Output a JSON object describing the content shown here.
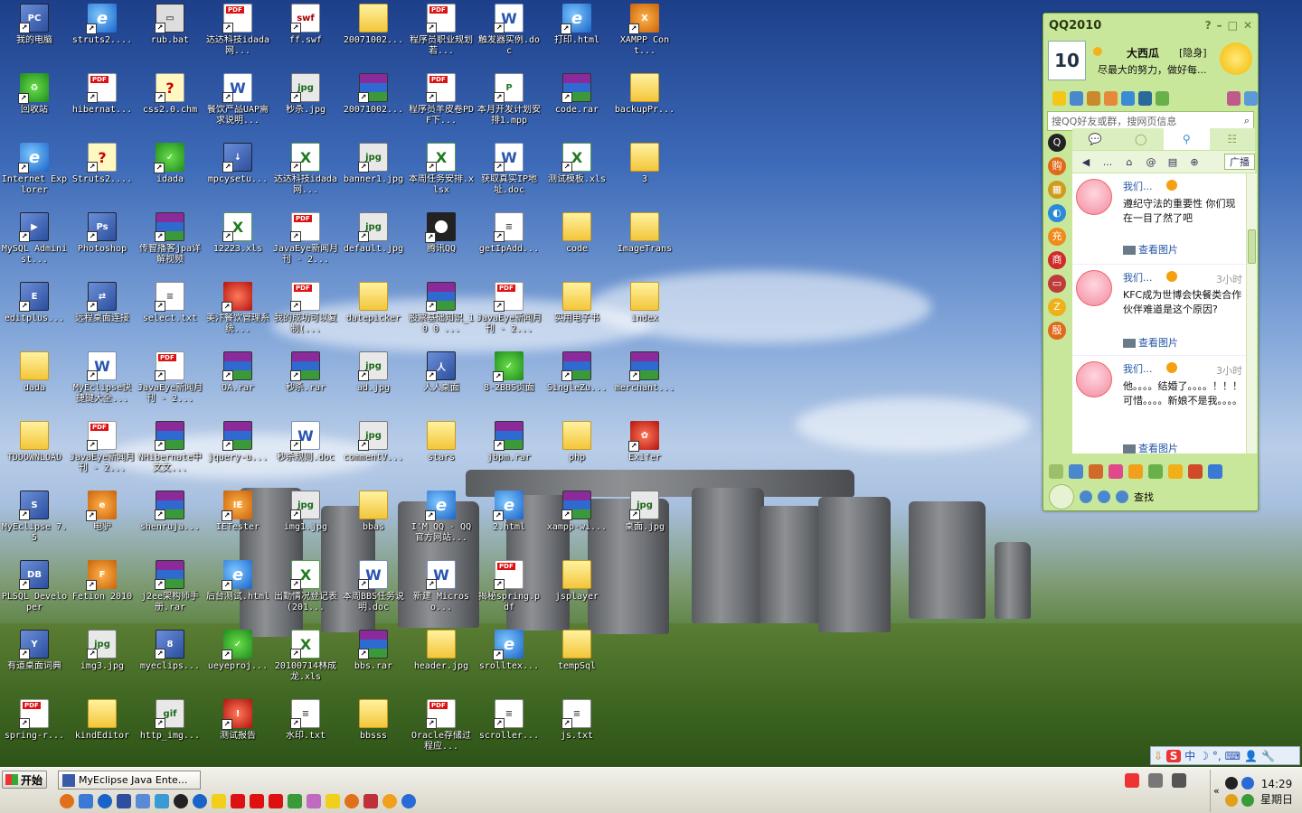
{
  "desktop": {
    "icons": [
      {
        "label": "我的电脑",
        "type": "app",
        "glyph": "PC"
      },
      {
        "label": "回收站",
        "type": "green",
        "glyph": "♻"
      },
      {
        "label": "Internet Explorer",
        "type": "ie",
        "glyph": "e"
      },
      {
        "label": "MySQL Administ...",
        "type": "app",
        "glyph": "▶"
      },
      {
        "label": "editplus...",
        "type": "app",
        "glyph": "E"
      },
      {
        "label": "dada",
        "type": "folder",
        "glyph": ""
      },
      {
        "label": "TDDOWNLOAD",
        "type": "folder",
        "glyph": ""
      },
      {
        "label": "MyEclipse 7.5",
        "type": "app",
        "glyph": "S"
      },
      {
        "label": "PLSQL Developer",
        "type": "app",
        "glyph": "DB"
      },
      {
        "label": "有道桌面词典",
        "type": "app",
        "glyph": "Y"
      },
      {
        "label": "spring-r...",
        "type": "pdf",
        "glyph": ""
      },
      {
        "label": "struts2....",
        "type": "ie",
        "glyph": "e"
      },
      {
        "label": "hibernat...",
        "type": "pdf",
        "glyph": ""
      },
      {
        "label": "Struts2....",
        "type": "chm",
        "glyph": "?"
      },
      {
        "label": "Photoshop",
        "type": "app",
        "glyph": "Ps"
      },
      {
        "label": "远程桌面连接",
        "type": "app",
        "glyph": "⇄"
      },
      {
        "label": "MyEclipse快捷键大全...",
        "type": "doc",
        "glyph": "W"
      },
      {
        "label": "JavaEye新闻月刊 - 2...",
        "type": "pdf",
        "glyph": ""
      },
      {
        "label": "电驴",
        "type": "orange",
        "glyph": "e"
      },
      {
        "label": "Fetion 2010",
        "type": "orange",
        "glyph": "F"
      },
      {
        "label": "img3.jpg",
        "type": "jpg",
        "glyph": "jpg"
      },
      {
        "label": "kindEditor",
        "type": "folder",
        "glyph": ""
      },
      {
        "label": "rub.bat",
        "type": "bat",
        "glyph": "▭"
      },
      {
        "label": "css2.0.chm",
        "type": "chm",
        "glyph": "?"
      },
      {
        "label": "idada",
        "type": "green",
        "glyph": "✓"
      },
      {
        "label": "传智播客jpa详解视频",
        "type": "rar",
        "glyph": ""
      },
      {
        "label": "select.txt",
        "type": "txt",
        "glyph": "≡"
      },
      {
        "label": "JavaEye新闻月刊 - 2...",
        "type": "pdf",
        "glyph": ""
      },
      {
        "label": "NHibernate中文文...",
        "type": "rar",
        "glyph": ""
      },
      {
        "label": "shenruja...",
        "type": "rar",
        "glyph": ""
      },
      {
        "label": "j2ee架构师手册.rar",
        "type": "rar",
        "glyph": ""
      },
      {
        "label": "myeclips...",
        "type": "app",
        "glyph": "8"
      },
      {
        "label": "http_img...",
        "type": "jpg",
        "glyph": "gif"
      },
      {
        "label": "达达科技idada网...",
        "type": "pdf",
        "glyph": ""
      },
      {
        "label": "餐饮产品UAP需求说明...",
        "type": "doc",
        "glyph": "W"
      },
      {
        "label": "mpcysetu...",
        "type": "app",
        "glyph": "↓"
      },
      {
        "label": "12223.xls",
        "type": "xls",
        "glyph": "X"
      },
      {
        "label": "美汴餐饮管理系统...",
        "type": "red",
        "glyph": ""
      },
      {
        "label": "OA.rar",
        "type": "rar",
        "glyph": ""
      },
      {
        "label": "jquery-u...",
        "type": "rar",
        "glyph": ""
      },
      {
        "label": "IETester",
        "type": "orange",
        "glyph": "IE"
      },
      {
        "label": "后台测试.html",
        "type": "ie",
        "glyph": "e"
      },
      {
        "label": "ueyeproj...",
        "type": "green",
        "glyph": "✓"
      },
      {
        "label": "测试报告",
        "type": "red",
        "glyph": "!"
      },
      {
        "label": "ff.swf",
        "type": "swf",
        "glyph": "swf"
      },
      {
        "label": "秒杀.jpg",
        "type": "jpg",
        "glyph": "jpg"
      },
      {
        "label": "达达科技idada网...",
        "type": "xls",
        "glyph": "X"
      },
      {
        "label": "JavaEye新闻月刊 - 2...",
        "type": "pdf",
        "glyph": ""
      },
      {
        "label": "我的成功可以复制(...",
        "type": "pdf",
        "glyph": ""
      },
      {
        "label": "秒杀.rar",
        "type": "rar",
        "glyph": ""
      },
      {
        "label": "秒杀规则.doc",
        "type": "doc",
        "glyph": "W"
      },
      {
        "label": "img1.jpg",
        "type": "jpg",
        "glyph": "jpg"
      },
      {
        "label": "出勤情况登记表(201...",
        "type": "xls",
        "glyph": "X"
      },
      {
        "label": "20100714林成龙.xls",
        "type": "xls",
        "glyph": "X"
      },
      {
        "label": "水印.txt",
        "type": "txt",
        "glyph": "≡"
      },
      {
        "label": "20071002...",
        "type": "folder",
        "glyph": ""
      },
      {
        "label": "20071002...",
        "type": "rar",
        "glyph": ""
      },
      {
        "label": "banner1.jpg",
        "type": "jpg",
        "glyph": "jpg"
      },
      {
        "label": "default.jpg",
        "type": "jpg",
        "glyph": "jpg"
      },
      {
        "label": "datepicker",
        "type": "folder",
        "glyph": ""
      },
      {
        "label": "ad.jpg",
        "type": "jpg",
        "glyph": "jpg"
      },
      {
        "label": "commentV...",
        "type": "jpg",
        "glyph": "jpg"
      },
      {
        "label": "bbas",
        "type": "folder",
        "glyph": ""
      },
      {
        "label": "本周BBS任务说明.doc",
        "type": "doc",
        "glyph": "W"
      },
      {
        "label": "bbs.rar",
        "type": "rar",
        "glyph": ""
      },
      {
        "label": "bbsss",
        "type": "folder",
        "glyph": ""
      },
      {
        "label": "程序员职业规划若...",
        "type": "pdf",
        "glyph": ""
      },
      {
        "label": "程序员羊皮卷PDF下...",
        "type": "pdf",
        "glyph": ""
      },
      {
        "label": "本周任务安排.xlsx",
        "type": "xls",
        "glyph": "X"
      },
      {
        "label": "腾讯QQ",
        "type": "qq",
        "glyph": ""
      },
      {
        "label": "股票基础知识_1 0 0 ...",
        "type": "rar",
        "glyph": ""
      },
      {
        "label": "人人桌面",
        "type": "app",
        "glyph": "人"
      },
      {
        "label": "stars",
        "type": "folder",
        "glyph": ""
      },
      {
        "label": "I'M QQ - QQ官方网站...",
        "type": "ie",
        "glyph": "e"
      },
      {
        "label": "新建 Microso...",
        "type": "doc",
        "glyph": "W"
      },
      {
        "label": "header.jpg",
        "type": "folder",
        "glyph": ""
      },
      {
        "label": "Oracle存储过程应...",
        "type": "pdf",
        "glyph": ""
      },
      {
        "label": "触发器实例.doc",
        "type": "doc",
        "glyph": "W"
      },
      {
        "label": "本月开发计划安排1.mpp",
        "type": "mpp",
        "glyph": "P"
      },
      {
        "label": "获取真实IP地址.doc",
        "type": "doc",
        "glyph": "W"
      },
      {
        "label": "getIpAdd...",
        "type": "txt",
        "glyph": "≡"
      },
      {
        "label": "JavaEye新闻月刊 - 2...",
        "type": "pdf",
        "glyph": ""
      },
      {
        "label": "8-2BBS页面",
        "type": "green",
        "glyph": "✓"
      },
      {
        "label": "jbpm.rar",
        "type": "rar",
        "glyph": ""
      },
      {
        "label": "2.html",
        "type": "ie",
        "glyph": "e"
      },
      {
        "label": "揭秘spring.pdf",
        "type": "pdf",
        "glyph": ""
      },
      {
        "label": "srolltex...",
        "type": "ie",
        "glyph": "e"
      },
      {
        "label": "scroller...",
        "type": "txt",
        "glyph": "≡"
      },
      {
        "label": "打印.html",
        "type": "ie",
        "glyph": "e"
      },
      {
        "label": "code.rar",
        "type": "rar",
        "glyph": ""
      },
      {
        "label": "测试模板.xls",
        "type": "xls",
        "glyph": "X"
      },
      {
        "label": "code",
        "type": "folder",
        "glyph": ""
      },
      {
        "label": "实用电子书",
        "type": "folder",
        "glyph": ""
      },
      {
        "label": "SingleZu...",
        "type": "rar",
        "glyph": ""
      },
      {
        "label": "php",
        "type": "folder",
        "glyph": ""
      },
      {
        "label": "xampp-wi...",
        "type": "rar",
        "glyph": ""
      },
      {
        "label": "jsplayer",
        "type": "folder",
        "glyph": ""
      },
      {
        "label": "tempSql",
        "type": "folder",
        "glyph": ""
      },
      {
        "label": "js.txt",
        "type": "txt",
        "glyph": "≡"
      },
      {
        "label": "XAMPP Cont...",
        "type": "orange",
        "glyph": "X"
      },
      {
        "label": "backupPr...",
        "type": "folder",
        "glyph": ""
      },
      {
        "label": "3",
        "type": "folder",
        "glyph": ""
      },
      {
        "label": "ImageTrans",
        "type": "folder",
        "glyph": ""
      },
      {
        "label": "index",
        "type": "folder",
        "glyph": ""
      },
      {
        "label": "merchant...",
        "type": "rar",
        "glyph": ""
      },
      {
        "label": "Exifer",
        "type": "red",
        "glyph": "✿"
      },
      {
        "label": "桌面.jpg",
        "type": "jpg",
        "glyph": "jpg"
      }
    ]
  },
  "qq": {
    "title": "QQ2010",
    "avatar_text": "10",
    "nickname": "大西瓜",
    "status": "[隐身]",
    "signature": "尽最大的努力，做好每...",
    "search_placeholder": "搜QQ好友或群，搜网页信息",
    "search_icon": "⌕",
    "tabs": [
      "💬",
      "◯",
      "⚲",
      "☷"
    ],
    "nav": [
      "◀",
      "...",
      "⌂",
      "@",
      "▤",
      "⊕"
    ],
    "broadcast_label": "广播",
    "posts": [
      {
        "who": "我们...",
        "time": "",
        "body": "遵纪守法的重要性 你们现在一目了然了吧",
        "pic": "查看图片"
      },
      {
        "who": "我们...",
        "time": "3小时",
        "body": "KFC成为世博会快餐类合作伙伴难道是这个原因?",
        "pic": "查看图片"
      },
      {
        "who": "我们...",
        "time": "3小时",
        "body": "他。。。。结婚了。。。。！！！可惜。。。。新娘不是我。。。。",
        "pic": "查看图片"
      }
    ],
    "find_label": "查找",
    "side_labels": [
      "Q",
      "购",
      "▦",
      "◐",
      "充",
      "商",
      "▭",
      "Z",
      "殷"
    ]
  },
  "ime": {
    "s": "S",
    "label": "中",
    "items": [
      "☽",
      "°,",
      "⌨",
      "👤",
      "🔧"
    ]
  },
  "taskbar": {
    "start_label": "开始",
    "task_label": "MyEclipse Java Ente...",
    "clock_time": "14:29",
    "clock_day": "星期日"
  },
  "colors": {
    "accent": "#c9e79a",
    "taskbar": "#e9e7dc"
  }
}
